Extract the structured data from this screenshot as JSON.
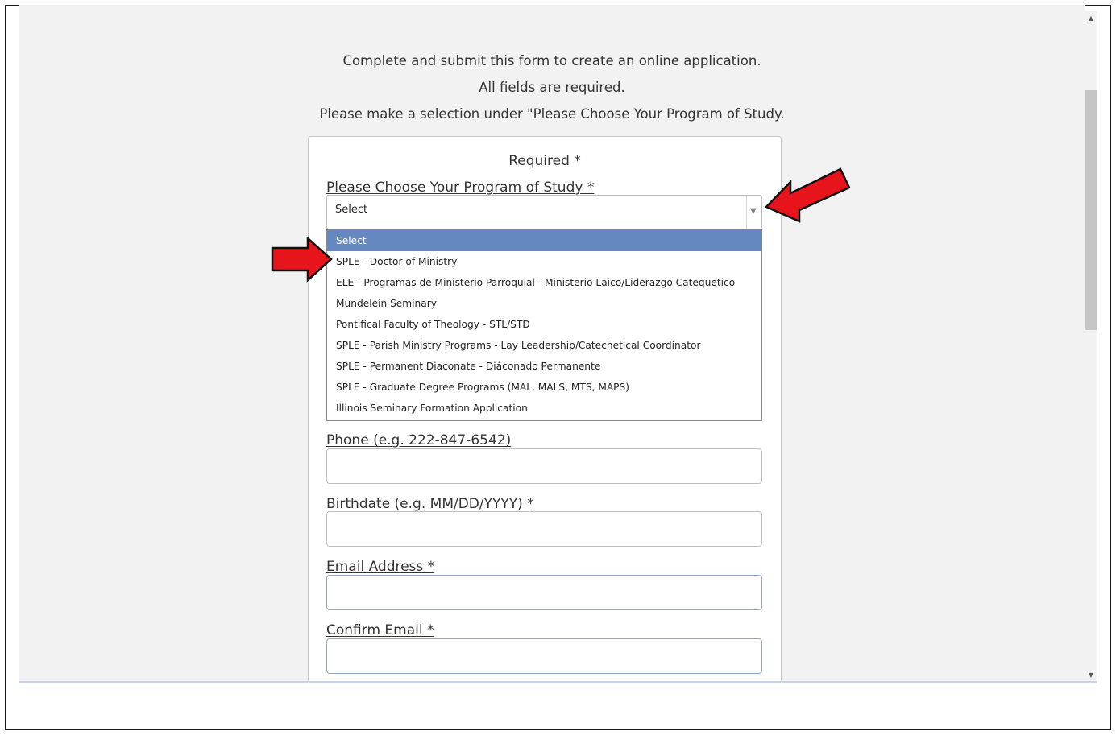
{
  "intro": {
    "line1": "Complete and submit this form to create an online application.",
    "line2": "All fields are required.",
    "line3": "Please make a selection under \"Please Choose Your Program of Study."
  },
  "form": {
    "required_title": "Required *",
    "program_label": "Please Choose Your Program of Study *",
    "program_select": {
      "value": "Select",
      "options": [
        "Select",
        "SPLE - Doctor of Ministry",
        "ELE - Programas de Ministerio Parroquial - Ministerio Laico/Liderazgo Catequetico",
        "Mundelein Seminary",
        "Pontifical Faculty of Theology - STL/STD",
        "SPLE - Parish Ministry Programs - Lay Leadership/Catechetical Coordinator",
        "SPLE - Permanent Diaconate - Diáconado Permanente",
        "SPLE - Graduate Degree Programs (MAL, MALS, MTS, MAPS)",
        "Illinois Seminary Formation Application"
      ]
    },
    "phone_label": "Phone (e.g. 222-847-6542)",
    "birthdate_label": "Birthdate (e.g. MM/DD/YYYY) *",
    "email_label": "Email Address *",
    "confirm_email_label": "Confirm Email *"
  },
  "colors": {
    "highlight": "#6588c0",
    "annotation_arrow": "#e8141b"
  }
}
